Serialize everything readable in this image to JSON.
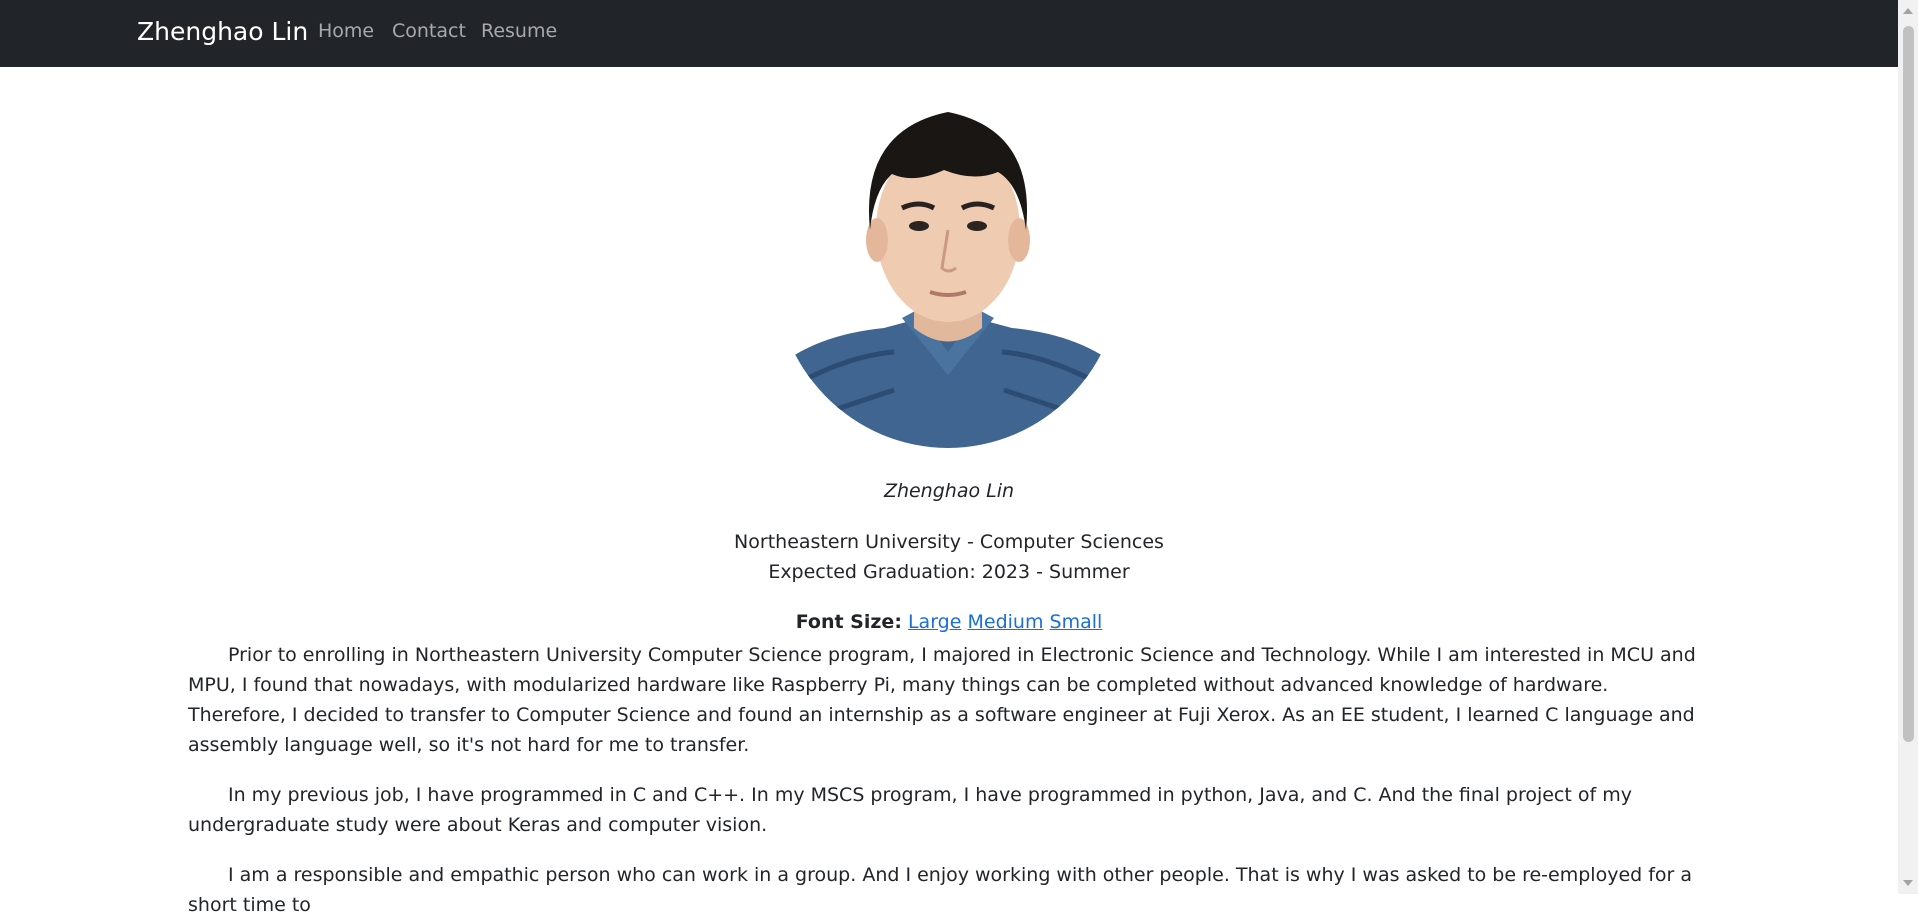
{
  "nav": {
    "brand": "Zhenghao Lin",
    "links": [
      "Home",
      "Contact",
      "Resume"
    ]
  },
  "profile": {
    "name": "Zhenghao Lin",
    "university": "Northeastern University - Computer Sciences",
    "graduation": "Expected Graduation: 2023 - Summer"
  },
  "font_size": {
    "label": "Font Size:",
    "options": [
      "Large",
      "Medium",
      "Small"
    ]
  },
  "paragraphs": [
    "Prior to enrolling in Northeastern University Computer Science program, I majored in Electronic Science and Technology. While I am interested in MCU and MPU, I found that nowadays, with modularized hardware like Raspberry Pi, many things can be completed without advanced knowledge of hardware. Therefore, I decided to transfer to Computer Science and found an internship as a software engineer at Fuji Xerox. As an EE student, I learned C language and assembly language well, so it's not hard for me to transfer.",
    "In my previous job, I have programmed in C and C++. In my MSCS program, I have programmed in python, Java, and C. And the final project of my undergraduate study were about Keras and computer vision.",
    "I am a responsible and empathic person who can work in a group. And I enjoy working with other people. That is why I was asked to be re-employed for a short time to"
  ],
  "colors": {
    "navbar_bg": "#212529",
    "link": "#1a6ed8",
    "text": "#212529"
  }
}
